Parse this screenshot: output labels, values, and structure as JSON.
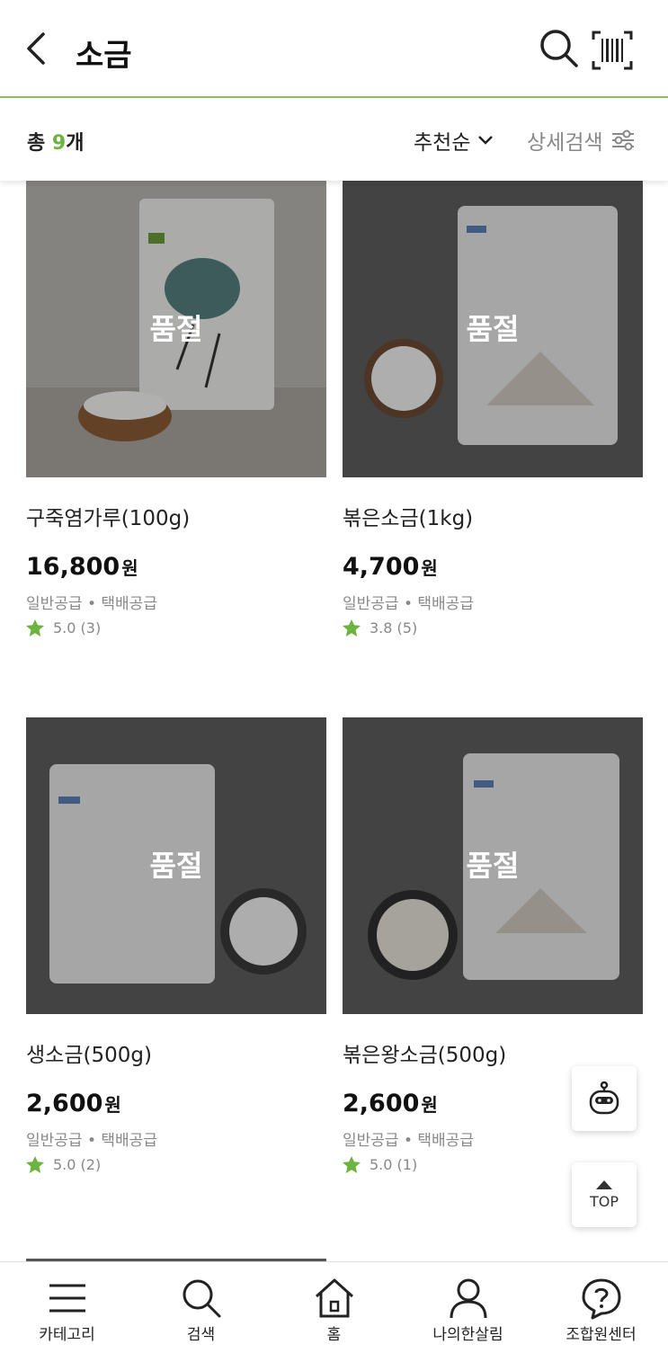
{
  "header": {
    "title": "소금"
  },
  "filter": {
    "total_prefix": "총 ",
    "total_count": "9",
    "total_suffix": "개",
    "sort_label": "추천순",
    "detail_label": "상세검색"
  },
  "products": [
    {
      "name": "구죽염가루(100g)",
      "price": "16,800",
      "currency": "원",
      "badge": "품절",
      "supply": "일반공급 • 택배공급",
      "rating": "5.0",
      "reviews": "(3)"
    },
    {
      "name": "볶은소금(1kg)",
      "price": "4,700",
      "currency": "원",
      "badge": "품절",
      "supply": "일반공급 • 택배공급",
      "rating": "3.8",
      "reviews": "(5)"
    },
    {
      "name": "생소금(500g)",
      "price": "2,600",
      "currency": "원",
      "badge": "품절",
      "supply": "일반공급 • 택배공급",
      "rating": "5.0",
      "reviews": "(2)"
    },
    {
      "name": "볶은왕소금(500g)",
      "price": "2,600",
      "currency": "원",
      "badge": "품절",
      "supply": "일반공급 • 택배공급",
      "rating": "5.0",
      "reviews": "(1)"
    }
  ],
  "fab": {
    "top_label": "TOP"
  },
  "nav": [
    {
      "label": "카테고리",
      "icon": "menu-icon"
    },
    {
      "label": "검색",
      "icon": "search-icon"
    },
    {
      "label": "홈",
      "icon": "home-icon"
    },
    {
      "label": "나의한살림",
      "icon": "person-icon"
    },
    {
      "label": "조합원센터",
      "icon": "help-icon"
    }
  ],
  "colors": {
    "accent": "#6cb33f",
    "star": "#6cb33f",
    "header_line": "#8cc152"
  }
}
